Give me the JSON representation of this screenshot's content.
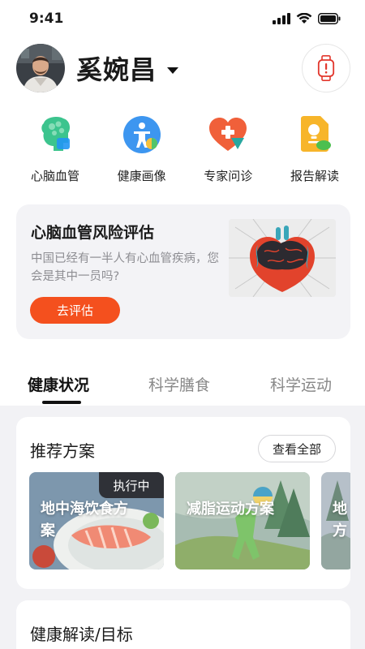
{
  "status_bar": {
    "time": "9:41"
  },
  "header": {
    "user_name": "奚婉昌"
  },
  "quick_nav": [
    {
      "label": "心脑血管",
      "icon": "brain-icon"
    },
    {
      "label": "健康画像",
      "icon": "person-icon"
    },
    {
      "label": "专家问诊",
      "icon": "medical-heart-icon"
    },
    {
      "label": "报告解读",
      "icon": "report-icon"
    }
  ],
  "risk_card": {
    "title": "心脑血管风险评估",
    "description": "中国已经有一半人有心血管疾病，您会是其中一员吗?",
    "button_label": "去评估"
  },
  "tabs": [
    {
      "label": "健康状况",
      "active": true
    },
    {
      "label": "科学膳食",
      "active": false
    },
    {
      "label": "科学运动",
      "active": false
    }
  ],
  "plans": {
    "title": "推荐方案",
    "view_all_label": "查看全部",
    "items": [
      {
        "label": "地中海饮食方案",
        "badge": "执行中"
      },
      {
        "label": "减脂运动方案"
      },
      {
        "label": "地方"
      }
    ]
  },
  "goals": {
    "title": "健康解读/目标"
  },
  "colors": {
    "accent": "#F4501E",
    "card_bg": "#F3F3F6",
    "page_bg": "#F2F2F5"
  }
}
